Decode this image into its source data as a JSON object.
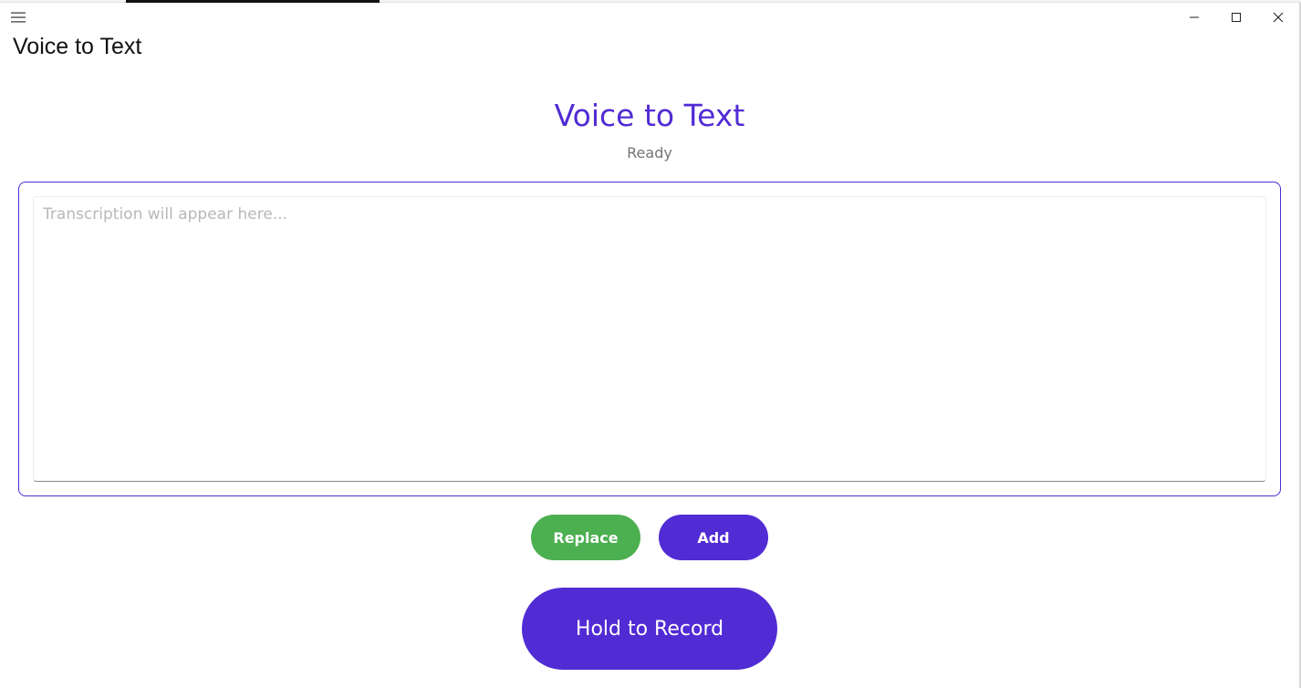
{
  "titlebar": {
    "title": "Voice to Text",
    "menu_icon": "hamburger-menu-icon",
    "minimize_icon": "minimize-icon",
    "maximize_icon": "maximize-icon",
    "close_icon": "close-icon"
  },
  "main": {
    "heading": "Voice to Text",
    "status": "Ready",
    "transcript": {
      "value": "",
      "placeholder": "Transcription will appear here..."
    },
    "replace_label": "Replace",
    "add_label": "Add",
    "record_label": "Hold to Record"
  },
  "colors": {
    "primary": "#512bd4",
    "replace": "#4caf50",
    "status_text": "#757575"
  }
}
